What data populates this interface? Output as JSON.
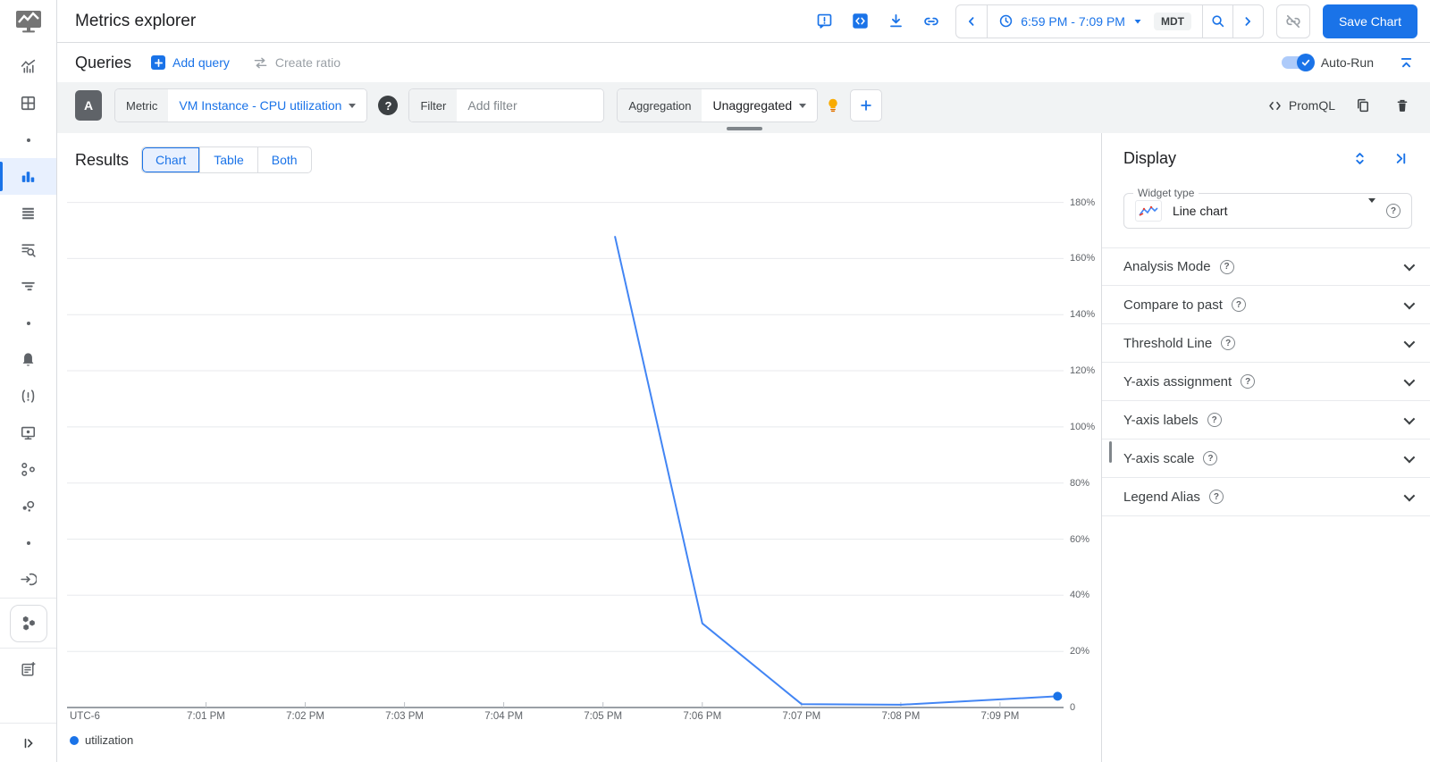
{
  "colors": {
    "primary": "#1a73e8",
    "chart_line": "#4285f4",
    "selected_tab_bg": "#e8f0fe",
    "row_bg": "#f1f3f4"
  },
  "header": {
    "title": "Metrics explorer",
    "time_range": {
      "value": "6:59 PM - 7:09 PM",
      "timezone": "MDT"
    },
    "save_button": "Save Chart"
  },
  "queries": {
    "title": "Queries",
    "add_query": "Add query",
    "create_ratio": "Create ratio",
    "auto_run": "Auto-Run"
  },
  "query_builder": {
    "query_letter": "A",
    "metric_label": "Metric",
    "metric_value": "VM Instance - CPU utilization",
    "filter_label": "Filter",
    "filter_placeholder": "Add filter",
    "aggregation_label": "Aggregation",
    "aggregation_value": "Unaggregated",
    "promql_label": "PromQL"
  },
  "results": {
    "title": "Results",
    "tabs": [
      {
        "label": "Chart",
        "selected": true
      },
      {
        "label": "Table",
        "selected": false
      },
      {
        "label": "Both",
        "selected": false
      }
    ]
  },
  "display": {
    "title": "Display",
    "widget_type_label": "Widget type",
    "widget_type_value": "Line chart",
    "sections": [
      {
        "label": "Analysis Mode"
      },
      {
        "label": "Compare to past"
      },
      {
        "label": "Threshold Line"
      },
      {
        "label": "Y-axis assignment"
      },
      {
        "label": "Y-axis labels"
      },
      {
        "label": "Y-axis scale"
      },
      {
        "label": "Legend Alias"
      }
    ]
  },
  "chart_data": {
    "type": "line",
    "title": "",
    "series": [
      {
        "name": "utilization",
        "color": "#4285f4",
        "points": [
          {
            "t": 5.12,
            "y": 168
          },
          {
            "t": 6.0,
            "y": 30
          },
          {
            "t": 7.0,
            "y": 1.2
          },
          {
            "t": 8.0,
            "y": 1.0
          },
          {
            "t": 9.58,
            "y": 4.0
          }
        ]
      }
    ],
    "x_axis": {
      "label": "UTC-6",
      "tick_labels": [
        "7:01 PM",
        "7:02 PM",
        "7:03 PM",
        "7:04 PM",
        "7:05 PM",
        "7:06 PM",
        "7:07 PM",
        "7:08 PM",
        "7:09 PM"
      ],
      "tick_minutes": [
        1,
        2,
        3,
        4,
        5,
        6,
        7,
        8,
        9
      ],
      "range_minutes": [
        -0.4,
        9.64
      ]
    },
    "y_axis": {
      "unit": "%",
      "tick_labels": [
        "180%",
        "160%",
        "140%",
        "120%",
        "100%",
        "80%",
        "60%",
        "40%",
        "20%",
        "0"
      ],
      "tick_values": [
        180,
        160,
        140,
        120,
        100,
        80,
        60,
        40,
        20,
        0
      ],
      "render_max": 184,
      "min": 0
    },
    "legend": [
      {
        "label": "utilization",
        "color": "#1a73e8"
      }
    ],
    "grid": true,
    "legend_position": "bottom-left"
  }
}
